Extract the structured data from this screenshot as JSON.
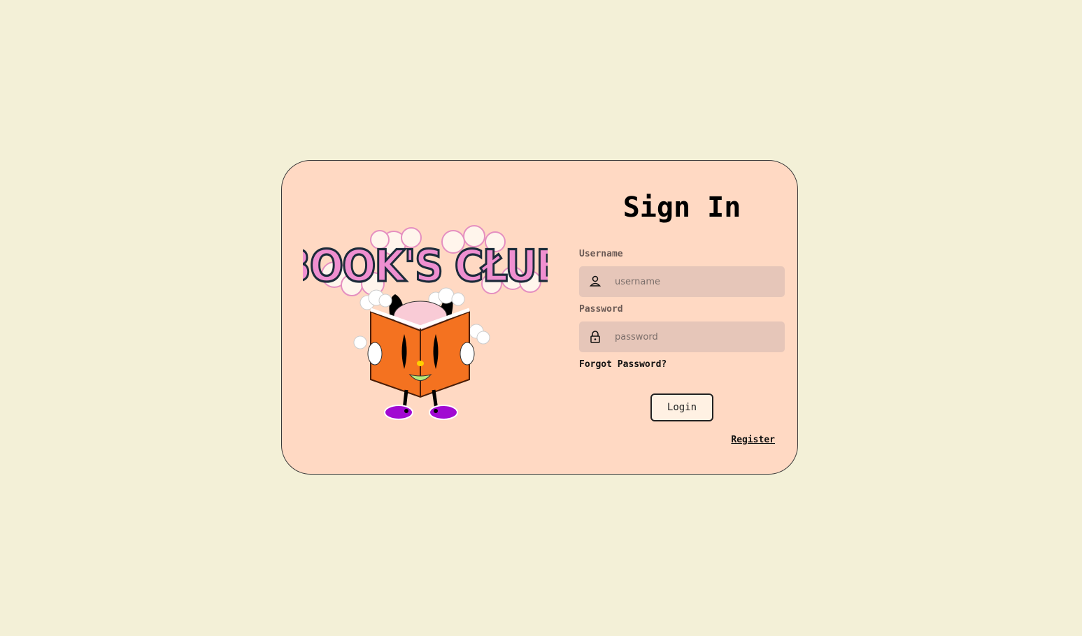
{
  "logo": {
    "text": "BOOK'S CŁUB"
  },
  "form": {
    "title": "Sign In",
    "username_label": "Username",
    "username_placeholder": "username",
    "password_label": "Password",
    "password_placeholder": "password",
    "forgot_label": "Forgot Password?",
    "login_label": "Login",
    "register_label": "Register"
  },
  "icons": {
    "username": "user-icon",
    "password": "lock-icon"
  },
  "colors": {
    "page_bg": "#f3f0d7",
    "card_bg": "#ffd9c3",
    "input_bg": "#e6c6b9",
    "button_bg": "#fff1e3",
    "logo_pink": "#ef8fd0",
    "book_orange": "#f47220"
  }
}
